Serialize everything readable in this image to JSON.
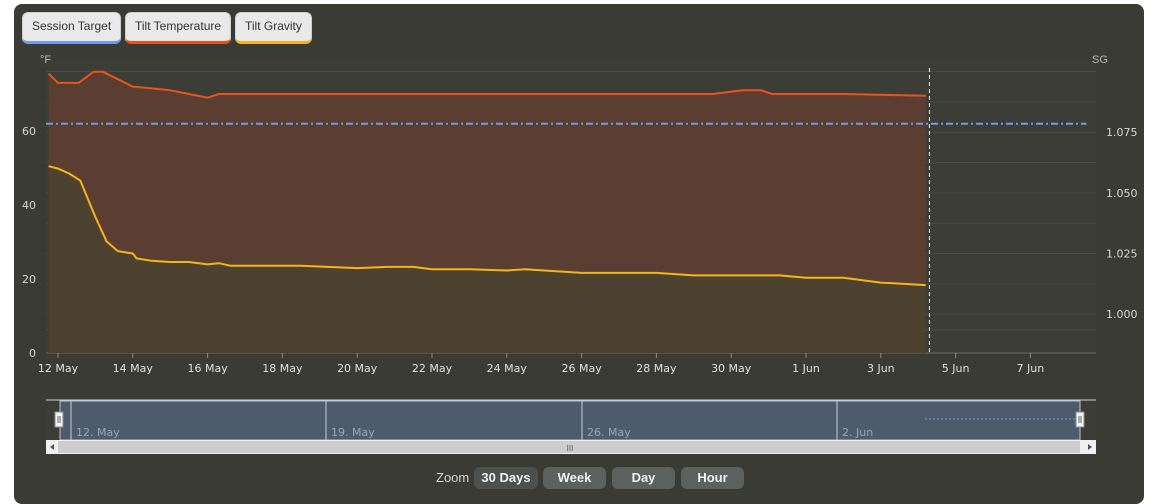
{
  "legend": [
    {
      "label": "Session Target",
      "color": "#6f9ee6"
    },
    {
      "label": "Tilt Temperature",
      "color": "#e8541b"
    },
    {
      "label": "Tilt Gravity",
      "color": "#f5b418"
    }
  ],
  "zoom": {
    "label": "Zoom",
    "buttons": [
      "30 Days",
      "Week",
      "Day",
      "Hour"
    ],
    "selected": "30 Days"
  },
  "navigator": {
    "labels": [
      "12. May",
      "19. May",
      "26. May",
      "2. Jun"
    ],
    "scroll_grip": "III"
  },
  "chart_data": {
    "type": "line",
    "x_unit": "days since 12 May",
    "x_range": [
      -0.5,
      27.5
    ],
    "x_tick_labels": [
      "12 May",
      "14 May",
      "16 May",
      "18 May",
      "20 May",
      "22 May",
      "24 May",
      "26 May",
      "28 May",
      "30 May",
      "1 Jun",
      "3 Jun",
      "5 Jun",
      "7 Jun"
    ],
    "x_tick_values": [
      0,
      2,
      4,
      6,
      8,
      10,
      12,
      14,
      16,
      18,
      20,
      22,
      24,
      26
    ],
    "left_axis": {
      "label": "°F",
      "range": [
        0,
        80
      ],
      "ticks": [
        0,
        20,
        40,
        60
      ]
    },
    "right_axis": {
      "label": "SG",
      "range": [
        0.984,
        1.106
      ],
      "ticks": [
        "1.000",
        "1.025",
        "1.050",
        "1.075"
      ],
      "tick_values": [
        1.0,
        1.025,
        1.05,
        1.075
      ]
    },
    "now_marker_x": 23.3,
    "series": [
      {
        "name": "Session Target",
        "axis": "right",
        "color": "#6f9ee6",
        "style": "dashdot",
        "x": [
          -0.5,
          27.5
        ],
        "y": [
          1.0785,
          1.0785
        ]
      },
      {
        "name": "Tilt Temperature",
        "axis": "left",
        "color": "#e8541b",
        "fill": "#5b3e30",
        "x": [
          -0.25,
          0,
          0.55,
          0.95,
          1.2,
          1.6,
          2.0,
          2.5,
          3.0,
          3.5,
          4.0,
          4.3,
          5,
          8,
          10,
          12,
          14,
          16,
          17.5,
          18.3,
          18.8,
          19.1,
          19.5,
          21,
          23.2
        ],
        "y": [
          75.5,
          73,
          73,
          76,
          76,
          74,
          72,
          71.5,
          71,
          70,
          69,
          70,
          70,
          70,
          70,
          70,
          70,
          70,
          70,
          71,
          71,
          70,
          70,
          70,
          69.5
        ]
      },
      {
        "name": "Tilt Gravity",
        "axis": "right",
        "color": "#f5b418",
        "fill": "#4d4130",
        "x": [
          -0.25,
          0,
          0.3,
          0.6,
          1.0,
          1.3,
          1.6,
          2.0,
          2.1,
          2.5,
          3.0,
          3.5,
          4.0,
          4.3,
          4.6,
          5,
          6.5,
          8,
          8.8,
          9.5,
          10,
          11,
          12,
          12.5,
          13,
          14,
          15,
          16,
          17,
          18,
          19.3,
          20,
          20.4,
          21,
          22,
          23.2
        ],
        "y": [
          1.061,
          1.06,
          1.058,
          1.055,
          1.04,
          1.03,
          1.026,
          1.025,
          1.023,
          1.022,
          1.0215,
          1.0215,
          1.0205,
          1.021,
          1.02,
          1.02,
          1.02,
          1.019,
          1.0195,
          1.0195,
          1.0185,
          1.0185,
          1.018,
          1.0185,
          1.018,
          1.017,
          1.017,
          1.017,
          1.016,
          1.016,
          1.016,
          1.015,
          1.015,
          1.015,
          1.013,
          1.012
        ]
      }
    ]
  }
}
